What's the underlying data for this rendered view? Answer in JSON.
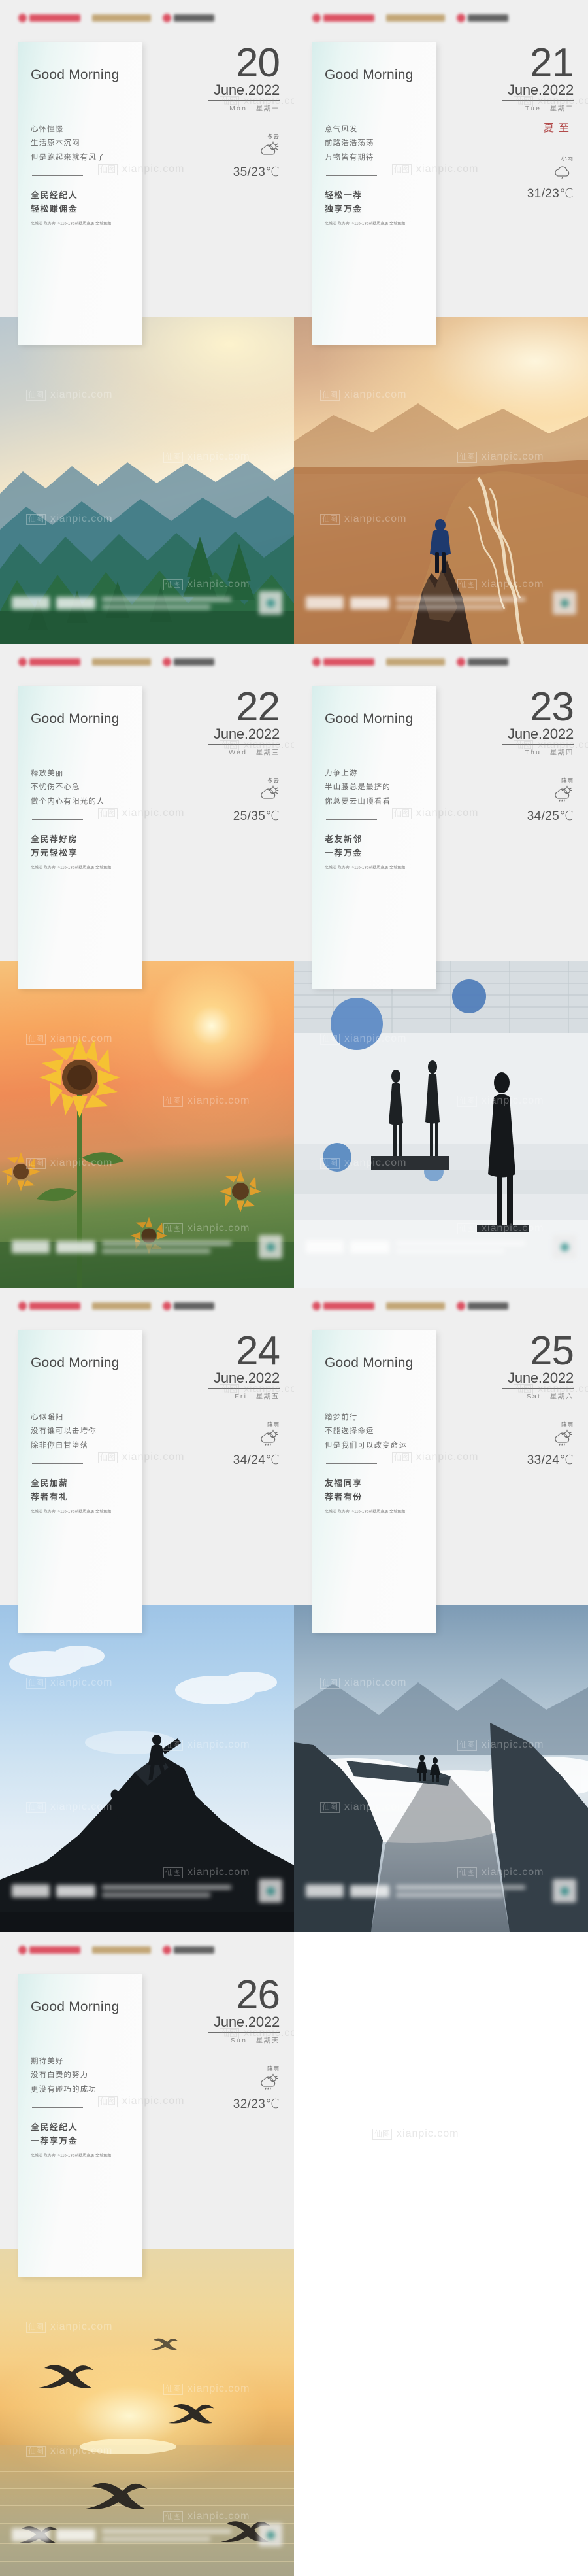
{
  "page": {
    "watermark_cn": "仙图",
    "watermark_en": "xianpic.com",
    "greeting": "Good Morning",
    "month_year": "June.2022",
    "fineprint": "北城芯 政务旁 ·≈116-136㎡墅质宽居 全城免藏",
    "accent_red": "#b24a4a",
    "card_gradient_from": "#d8eeec",
    "card_gradient_to": "#fcfcfc",
    "page_bg": "#efefef"
  },
  "cards": [
    {
      "day": "20",
      "month_year": "June.2022",
      "weekday_en": "Mon",
      "weekday_cn": "星期一",
      "solar_term": "",
      "weather_label": "多云",
      "weather_icon": "cloud-sun-icon",
      "temperature": "35/23℃",
      "quote": [
        "心怀憧憬",
        "生活原本沉闷",
        "但是跑起来就有风了"
      ],
      "slogan": [
        "全民经纪人",
        "轻松赚佣金"
      ],
      "fineprint": "北城芯 政务旁 ·≈116-136㎡墅质宽居 全城免藏",
      "photo": "misty-pine-forest-sunrise"
    },
    {
      "day": "21",
      "month_year": "June.2022",
      "weekday_en": "Tue",
      "weekday_cn": "星期二",
      "solar_term": "夏至",
      "weather_label": "小雨",
      "weather_icon": "rain-cloud-icon",
      "temperature": "31/23℃",
      "quote": [
        "意气风发",
        "前路浩浩荡荡",
        "万物皆有期待"
      ],
      "slogan": [
        "轻松一荐",
        "独享万金"
      ],
      "fineprint": "北城芯 政务旁 ·≈116-136㎡墅质宽居 全城免藏",
      "photo": "hiker-on-rock-canyon-river"
    },
    {
      "day": "22",
      "month_year": "June.2022",
      "weekday_en": "Wed",
      "weekday_cn": "星期三",
      "solar_term": "",
      "weather_label": "多云",
      "weather_icon": "cloud-sun-icon",
      "temperature": "25/35℃",
      "quote": [
        "释放美丽",
        "不忧伤不心急",
        "做个内心有阳光的人"
      ],
      "slogan": [
        "全民荐好房",
        "万元轻松享"
      ],
      "fineprint": "北城芯 政务旁 ·≈116-136㎡墅质宽居 全城免藏",
      "photo": "sunflower-field-sunset"
    },
    {
      "day": "23",
      "month_year": "June.2022",
      "weekday_en": "Thu",
      "weekday_cn": "星期四",
      "solar_term": "",
      "weather_label": "阵雨",
      "weather_icon": "shower-sun-icon",
      "temperature": "34/25℃",
      "quote": [
        "力争上游",
        "半山腰总是最挤的",
        "你总要去山顶看看"
      ],
      "slogan": [
        "老友新邻",
        "一荐万金"
      ],
      "fineprint": "北城芯 政务旁 ·≈116-136㎡墅质宽居 全城免藏",
      "photo": "gallery-sculptures-blue-spheres"
    },
    {
      "day": "24",
      "month_year": "June.2022",
      "weekday_en": "Fri",
      "weekday_cn": "星期五",
      "solar_term": "",
      "weather_label": "阵雨",
      "weather_icon": "shower-sun-icon",
      "temperature": "34/24℃",
      "quote": [
        "心似暖阳",
        "没有谁可以击垮你",
        "除非你自甘堕落"
      ],
      "slogan": [
        "全民加薪",
        "荐者有礼"
      ],
      "fineprint": "北城芯 政务旁 ·≈116-136㎡墅质宽居 全城免藏",
      "photo": "climbers-helping-hand-cliff"
    },
    {
      "day": "25",
      "month_year": "June.2022",
      "weekday_en": "Sat",
      "weekday_cn": "星期六",
      "solar_term": "",
      "weather_label": "阵雨",
      "weather_icon": "shower-sun-icon",
      "temperature": "33/24℃",
      "quote": [
        "踏梦前行",
        "不能选择命运",
        "但是我们可以改变命运"
      ],
      "slogan": [
        "友福同享",
        "荐者有份"
      ],
      "fineprint": "北城芯 政务旁 ·≈116-136㎡墅质宽居 全城免藏",
      "photo": "hikers-on-cliff-edge-above-clouds"
    },
    {
      "day": "26",
      "month_year": "June.2022",
      "weekday_en": "Sun",
      "weekday_cn": "星期天",
      "solar_term": "",
      "weather_label": "阵雨",
      "weather_icon": "shower-sun-icon",
      "temperature": "32/23℃",
      "quote": [
        "期待美好",
        "没有白费的努力",
        "更没有碰巧的成功"
      ],
      "slogan": [
        "全民经纪人",
        "一荐享万金"
      ],
      "fineprint": "北城芯 政务旁 ·≈116-136㎡墅质宽居 全城免藏",
      "photo": "seagulls-over-golden-lake-sunset"
    }
  ]
}
